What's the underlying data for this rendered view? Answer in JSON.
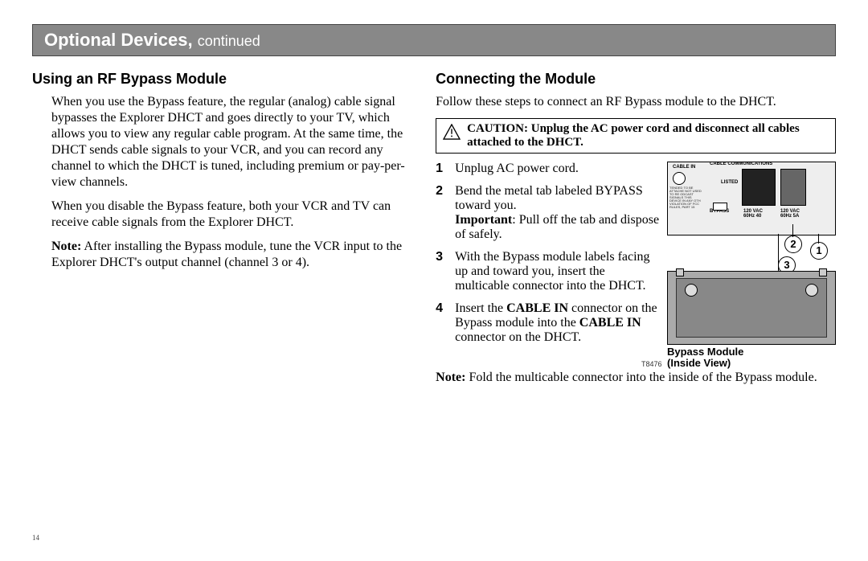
{
  "header": {
    "title": "Optional Devices,",
    "cont": "continued"
  },
  "left": {
    "heading": "Using an RF Bypass Module",
    "p1": "When you use the Bypass feature, the regular (analog) cable signal bypasses the Explorer DHCT and goes directly to your TV, which allows you to view any regular cable program. At the same time, the DHCT sends cable signals to your VCR, and you can record any channel to which the DHCT is tuned, including premium or pay-per-view channels.",
    "p2": "When you disable the Bypass feature, both your VCR and TV can receive cable signals from the Explorer DHCT.",
    "note_label": "Note:",
    "note_text": "  After installing the Bypass module, tune the VCR input to the Explorer DHCT's output channel (channel 3 or 4)."
  },
  "right": {
    "heading": "Connecting the Module",
    "intro": "Follow these steps to connect an RF Bypass module to the DHCT.",
    "caution_label": "CAUTION:",
    "caution_text": " Unplug the AC power cord and disconnect all cables attached to the DHCT.",
    "steps": [
      {
        "n": "1",
        "text": "Unplug AC power cord."
      },
      {
        "n": "2",
        "pre": "Bend the metal tab labeled BYPASS toward you. ",
        "imp_label": "Important",
        "imp_text": ": Pull off the tab and dispose of safely."
      },
      {
        "n": "3",
        "text": "With the Bypass module labels facing up and toward you, insert the multicable connector into the DHCT."
      },
      {
        "n": "4",
        "pre": "Insert the ",
        "bold1": "CABLE IN",
        "mid": " connector on the Bypass module into the ",
        "bold2": "CABLE IN",
        "post": " connector on the DHCT."
      }
    ],
    "note_label": "Note:",
    "note_text": " Fold the multicable connector into the inside of the Bypass module.",
    "diagram": {
      "cable_in": "CABLE IN",
      "cable_comms": "CABLE COMMUNICATIONS",
      "bypass": "BYPASS",
      "v1": "120 VAC 60Hz 40",
      "v2": "120 VAC 60Hz 5A",
      "ul": "LISTED",
      "caption1": "Bypass Module",
      "caption2": "(Inside View)",
      "tcode": "T8476"
    }
  },
  "page": "14"
}
